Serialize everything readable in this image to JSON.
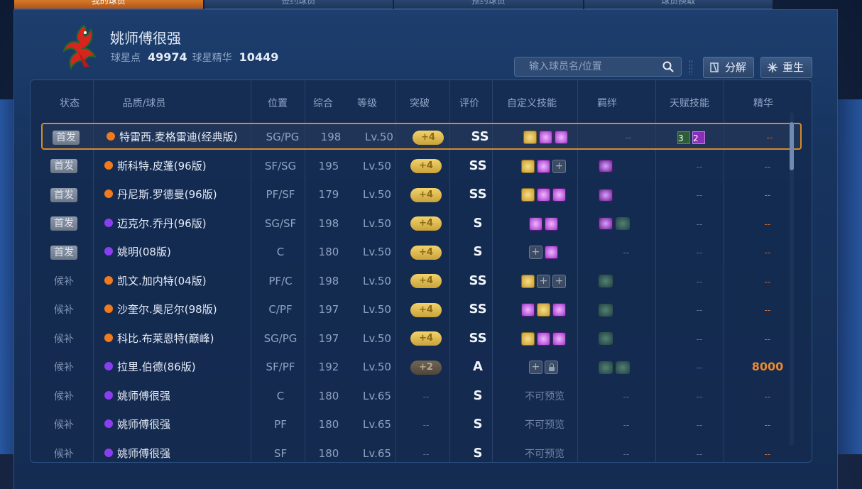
{
  "tabs": [
    "我的球员",
    "签约球员",
    "预约球员",
    "球员换取"
  ],
  "team": {
    "name": "姚师傅很强"
  },
  "currency": {
    "star_label": "球星点",
    "star_value": "49974",
    "essence_label": "球星精华",
    "essence_value": "10449"
  },
  "search": {
    "placeholder": "输入球员名/位置"
  },
  "buttons": {
    "decompose": "分解",
    "reborn": "重生"
  },
  "columns": [
    "状态",
    "品质/球员",
    "位置",
    "综合",
    "等级",
    "突破",
    "评价",
    "自定义技能",
    "羁绊",
    "天赋技能",
    "精华"
  ],
  "colors": {
    "accent": "#d58a2c",
    "orange_quality": "#f07a1c",
    "purple_quality": "#8a3ef0",
    "essence": "#e88a2e"
  },
  "players": [
    {
      "status": "首发",
      "starter": true,
      "quality": "orange",
      "name": "特雷西.麦格雷迪(经典版)",
      "pos": "SG/PG",
      "ovr": "198",
      "level": "Lv.50",
      "breakthrough": "+4",
      "grade": "SS",
      "skills": [
        "gold",
        "purple",
        "purple"
      ],
      "bonds": [],
      "bond_text": "--",
      "talents": [
        {
          "v": "3",
          "c": "green"
        },
        {
          "v": "2",
          "c": "purple"
        }
      ],
      "talent_text": "",
      "essence": "--",
      "selected": true
    },
    {
      "status": "首发",
      "starter": true,
      "quality": "orange",
      "name": "斯科特.皮蓬(96版)",
      "pos": "SF/SG",
      "ovr": "195",
      "level": "Lv.50",
      "breakthrough": "+4",
      "grade": "SS",
      "skills": [
        "gold",
        "purple",
        "plus"
      ],
      "bonds": [
        "purple"
      ],
      "bond_text": "",
      "talents": [],
      "talent_text": "--",
      "essence": "--"
    },
    {
      "status": "首发",
      "starter": true,
      "quality": "orange",
      "name": "丹尼斯.罗德曼(96版)",
      "pos": "PF/SF",
      "ovr": "179",
      "level": "Lv.50",
      "breakthrough": "+4",
      "grade": "SS",
      "skills": [
        "gold",
        "purple",
        "purple"
      ],
      "bonds": [
        "purple"
      ],
      "bond_text": "",
      "talents": [],
      "talent_text": "--",
      "essence": "--"
    },
    {
      "status": "首发",
      "starter": true,
      "quality": "purple",
      "name": "迈克尔.乔丹(96版)",
      "pos": "SG/SF",
      "ovr": "198",
      "level": "Lv.50",
      "breakthrough": "+4",
      "grade": "S",
      "skills": [
        "purple",
        "purple"
      ],
      "bonds": [
        "purple",
        "green"
      ],
      "bond_text": "",
      "talents": [],
      "talent_text": "--",
      "essence": "--"
    },
    {
      "status": "首发",
      "starter": true,
      "quality": "purple",
      "name": "姚明(08版)",
      "pos": "C",
      "ovr": "180",
      "level": "Lv.50",
      "breakthrough": "+4",
      "grade": "S",
      "skills": [
        "plus",
        "purple"
      ],
      "bonds": [],
      "bond_text": "--",
      "talents": [],
      "talent_text": "--",
      "essence": "--"
    },
    {
      "status": "候补",
      "starter": false,
      "quality": "orange",
      "name": "凯文.加内特(04版)",
      "pos": "PF/C",
      "ovr": "198",
      "level": "Lv.50",
      "breakthrough": "+4",
      "grade": "SS",
      "skills": [
        "gold",
        "plus",
        "plus"
      ],
      "bonds": [
        "green"
      ],
      "bond_text": "",
      "talents": [],
      "talent_text": "--",
      "essence": "--"
    },
    {
      "status": "候补",
      "starter": false,
      "quality": "orange",
      "name": "沙奎尔.奥尼尔(98版)",
      "pos": "C/PF",
      "ovr": "197",
      "level": "Lv.50",
      "breakthrough": "+4",
      "grade": "SS",
      "skills": [
        "purple",
        "gold",
        "purple"
      ],
      "bonds": [
        "green"
      ],
      "bond_text": "",
      "talents": [],
      "talent_text": "--",
      "essence": "--"
    },
    {
      "status": "候补",
      "starter": false,
      "quality": "orange",
      "name": "科比.布莱恩特(巅峰)",
      "pos": "SG/PG",
      "ovr": "197",
      "level": "Lv.50",
      "breakthrough": "+4",
      "grade": "SS",
      "skills": [
        "gold",
        "purple",
        "purple"
      ],
      "bonds": [
        "green"
      ],
      "bond_text": "",
      "talents": [],
      "talent_text": "--",
      "essence": "--"
    },
    {
      "status": "候补",
      "starter": false,
      "quality": "purple",
      "name": "拉里.伯德(86版)",
      "pos": "SF/PF",
      "ovr": "192",
      "level": "Lv.50",
      "breakthrough": "+2",
      "grade": "A",
      "skills": [
        "plus",
        "lock"
      ],
      "bonds": [
        "green",
        "green"
      ],
      "bond_text": "",
      "talents": [],
      "talent_text": "--",
      "essence": "8000"
    },
    {
      "status": "候补",
      "starter": false,
      "quality": "purple",
      "name": "姚师傅很强",
      "pos": "C",
      "ovr": "180",
      "level": "Lv.65",
      "breakthrough": "--",
      "grade": "S",
      "skills": [],
      "skill_text": "不可预览",
      "bonds": [],
      "bond_text": "--",
      "talents": [],
      "talent_text": "--",
      "essence": "--"
    },
    {
      "status": "候补",
      "starter": false,
      "quality": "purple",
      "name": "姚师傅很强",
      "pos": "PF",
      "ovr": "180",
      "level": "Lv.65",
      "breakthrough": "--",
      "grade": "S",
      "skills": [],
      "skill_text": "不可预览",
      "bonds": [],
      "bond_text": "--",
      "talents": [],
      "talent_text": "--",
      "essence": "--"
    },
    {
      "status": "候补",
      "starter": false,
      "quality": "purple",
      "name": "姚师傅很强",
      "pos": "SF",
      "ovr": "180",
      "level": "Lv.65",
      "breakthrough": "--",
      "grade": "S",
      "skills": [],
      "skill_text": "不可预览",
      "bonds": [],
      "bond_text": "--",
      "talents": [],
      "talent_text": "--",
      "essence": "--"
    }
  ]
}
